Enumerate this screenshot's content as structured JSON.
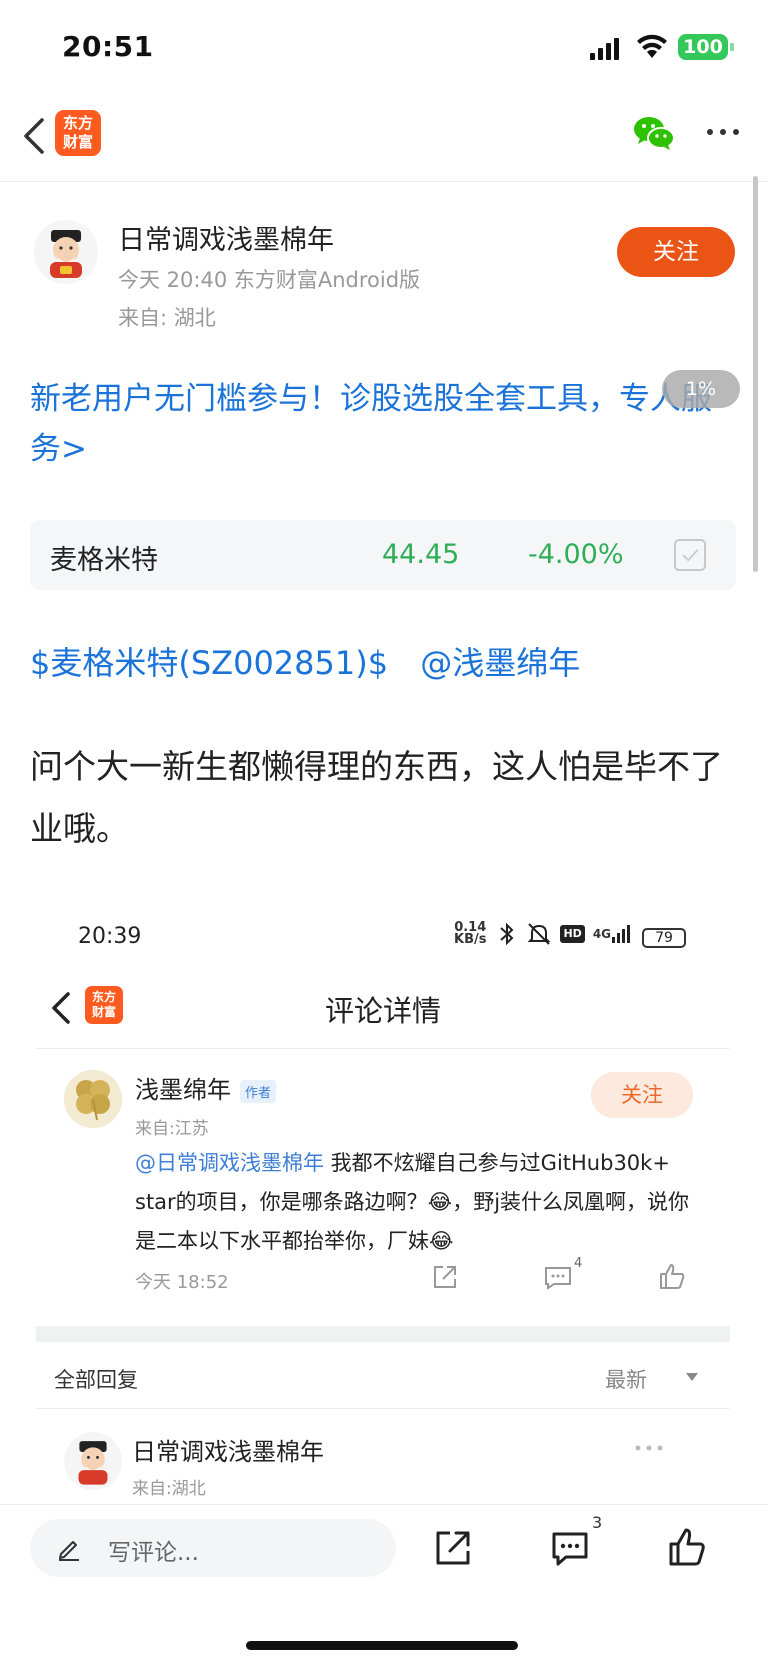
{
  "status_bar": {
    "time": "20:51",
    "battery": "100"
  },
  "nav": {
    "logo_text_line1": "东方",
    "logo_text_line2": "财富",
    "icons": [
      "back-icon",
      "wechat-icon",
      "more-icon"
    ]
  },
  "author": {
    "name": "日常调戏浅墨棉年",
    "meta": "今天 20:40 东方财富Android版",
    "location": "来自: 湖北",
    "follow_label": "关注"
  },
  "promo": {
    "text": "新老用户无门槛参与！诊股选股全套工具，专人服务>",
    "progress": "1%"
  },
  "stock": {
    "name": "麦格米特",
    "price": "44.45",
    "change": "-4.00%",
    "color": "#2fae57"
  },
  "tags": {
    "stock_tag": "$麦格米特(SZ002851)$",
    "mention": "@浅墨绵年"
  },
  "post": {
    "body": "问个大一新生都懒得理的东西，这人怕是毕不了业哦。"
  },
  "screenshot": {
    "time": "20:39",
    "net_speed_line1": "0.14",
    "net_speed_line2": "KB/s",
    "network": "4G",
    "hd": "HD",
    "battery": "79",
    "logo_line1": "东方",
    "logo_line2": "财富",
    "title": "评论详情",
    "comment": {
      "name": "浅墨绵年",
      "badge": "作者",
      "follow_label": "关注",
      "location": "来自:江苏",
      "mention": "@日常调戏浅墨棉年",
      "text": " 我都不炫耀自己参与过GitHub30k+ star的项目，你是哪条路边啊？😂，野j装什么凤凰啊，说你是二本以下水平都抬举你，厂妹😂",
      "time": "今天 18:52",
      "reply_count": "4"
    },
    "replies_title": "全部回复",
    "sort_label": "最新",
    "reply": {
      "name": "日常调戏浅墨棉年",
      "location": "来自:湖北"
    }
  },
  "bottom_bar": {
    "placeholder": "写评论...",
    "comment_count": "3"
  }
}
